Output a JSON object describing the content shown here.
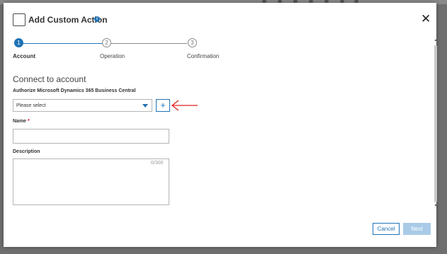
{
  "dialog": {
    "title": "Add Custom Action",
    "info_icon": "info-icon",
    "close_icon": "close-icon"
  },
  "stepper": {
    "steps": [
      {
        "number": "1",
        "label": "Account",
        "state": "active"
      },
      {
        "number": "2",
        "label": "Operation",
        "state": "inactive"
      },
      {
        "number": "3",
        "label": "Confirmation",
        "state": "inactive"
      }
    ]
  },
  "section": {
    "title": "Connect to account"
  },
  "account": {
    "label": "Authorize Microsoft Dynamics 365 Business Central",
    "select_value": "Please select",
    "add_label": "+"
  },
  "name": {
    "label": "Name",
    "required_mark": "*",
    "value": ""
  },
  "description": {
    "label": "Description",
    "value": "",
    "counter": "0/300"
  },
  "footer": {
    "cancel_label": "Cancel",
    "next_label": "Next"
  },
  "colors": {
    "accent": "#1f73b7",
    "disabled_button": "#a9cbe8",
    "arrow": "#e02020",
    "required": "#d0021b"
  }
}
